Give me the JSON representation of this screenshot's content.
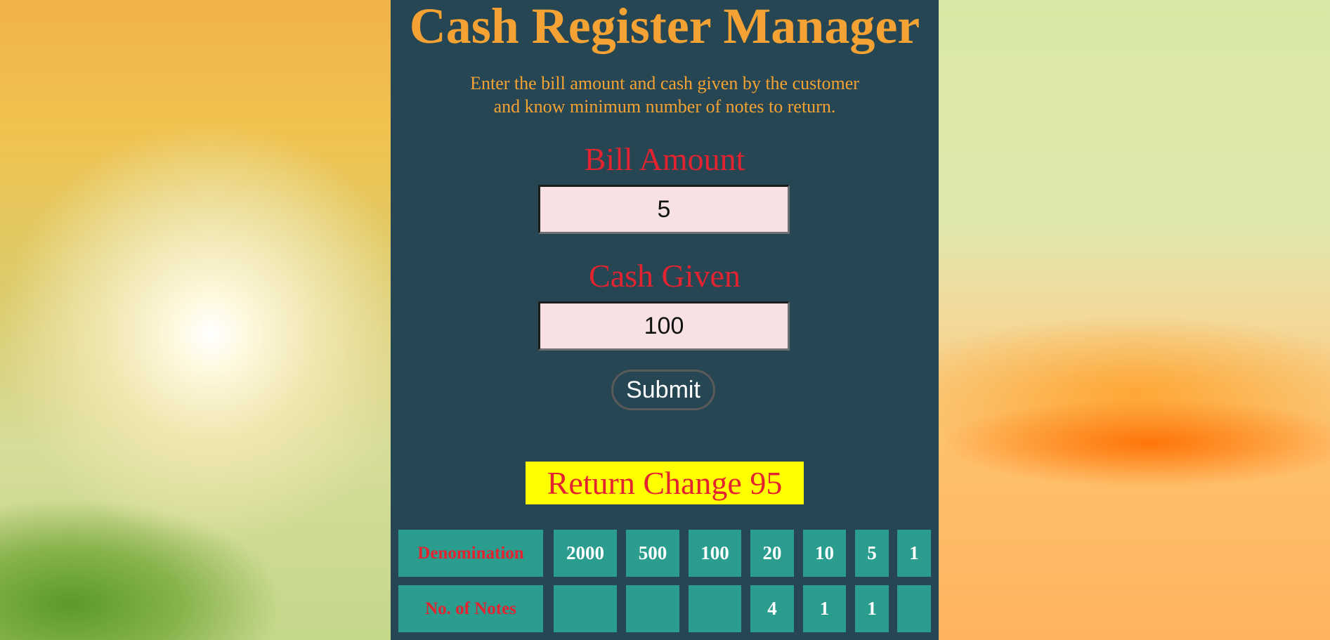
{
  "header": {
    "title": "Cash Register Manager",
    "subtitle_line1": "Enter the bill amount and cash given by the customer",
    "subtitle_line2": "and know minimum number of notes to return."
  },
  "form": {
    "bill_label": "Bill Amount",
    "bill_value": "5",
    "cash_label": "Cash Given",
    "cash_value": "100",
    "submit_label": "Submit"
  },
  "result": {
    "text": "Return Change 95"
  },
  "table": {
    "row_headers": [
      "Denomination",
      "No. of Notes"
    ],
    "denominations": [
      "2000",
      "500",
      "100",
      "20",
      "10",
      "5",
      "1"
    ],
    "notes": [
      "",
      "",
      "",
      "4",
      "1",
      "1",
      ""
    ]
  },
  "colors": {
    "panel": "#264653",
    "accent": "#f4a233",
    "label_red": "#e3232f",
    "cell_teal": "#2a9d8f",
    "result_bg": "#ffff00"
  }
}
